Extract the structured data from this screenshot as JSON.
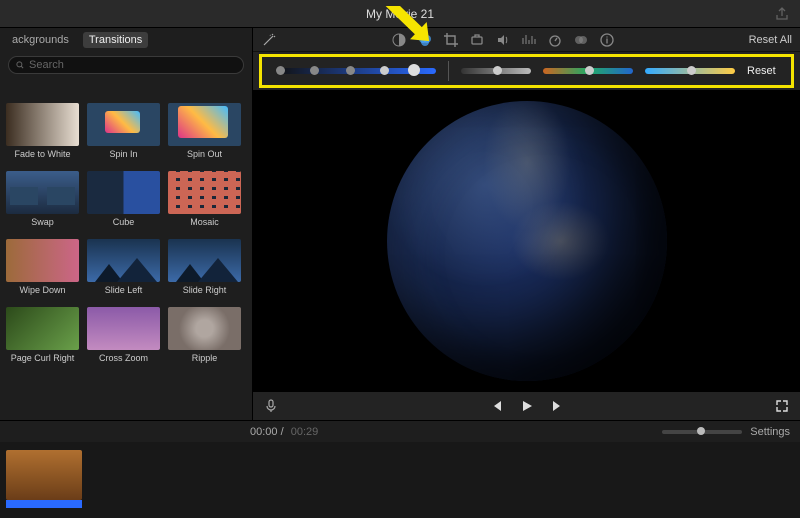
{
  "title": "My Movie 21",
  "tabs": {
    "backgrounds": "ackgrounds",
    "transitions": "Transitions"
  },
  "search": {
    "placeholder": "Search"
  },
  "transitions": [
    {
      "label": "Fade to White"
    },
    {
      "label": "Spin In"
    },
    {
      "label": "Spin Out"
    },
    {
      "label": "Swap"
    },
    {
      "label": "Cube"
    },
    {
      "label": "Mosaic"
    },
    {
      "label": "Wipe Down"
    },
    {
      "label": "Slide Left"
    },
    {
      "label": "Slide Right"
    },
    {
      "label": "Page Curl Right"
    },
    {
      "label": "Cross Zoom"
    },
    {
      "label": "Ripple"
    }
  ],
  "toolbar": {
    "reset_all": "Reset All",
    "reset": "Reset"
  },
  "time": {
    "position": "00:00",
    "duration": "00:29",
    "settings": "Settings"
  },
  "icons": {
    "balance": "color-balance-icon",
    "color": "color-correction-icon",
    "crop": "crop-icon",
    "stabilize": "stabilization-icon",
    "volume": "volume-icon",
    "noise": "noise-reduction-icon",
    "speed": "speed-icon",
    "filter": "clip-filter-icon",
    "info": "info-icon"
  }
}
